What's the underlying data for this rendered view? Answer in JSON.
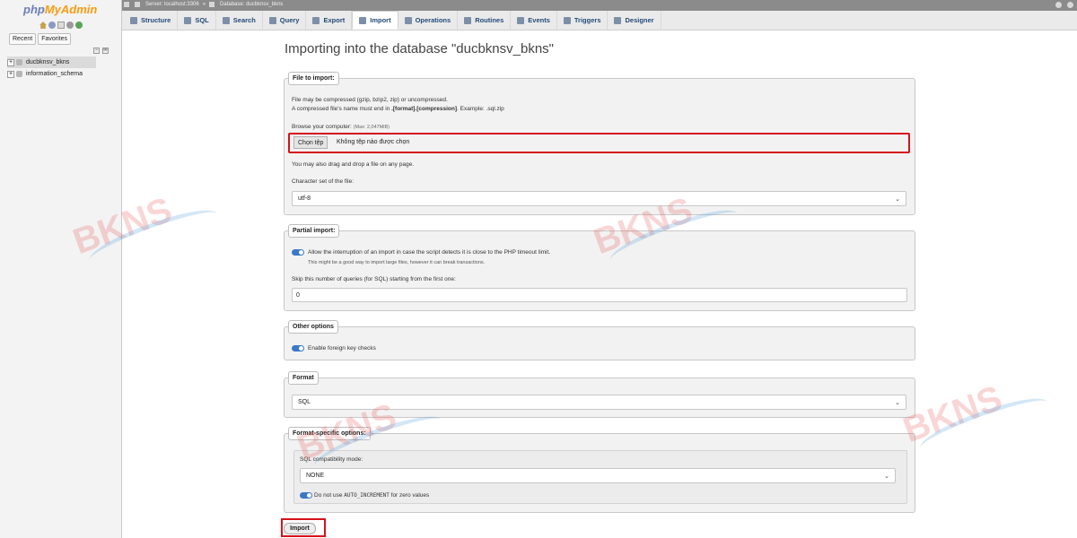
{
  "sidebar": {
    "logo_php": "php",
    "logo_myadmin": "MyAdmin",
    "recent": "Recent",
    "favorites": "Favorites",
    "databases": [
      "ducbknsv_bkns",
      "information_schema"
    ]
  },
  "breadcrumb": {
    "server": "Server: localhost:3306",
    "separator": "»",
    "database": "Database: ducbknsv_bkns"
  },
  "tabs": [
    {
      "label": "Structure"
    },
    {
      "label": "SQL"
    },
    {
      "label": "Search"
    },
    {
      "label": "Query"
    },
    {
      "label": "Export"
    },
    {
      "label": "Import"
    },
    {
      "label": "Operations"
    },
    {
      "label": "Routines"
    },
    {
      "label": "Events"
    },
    {
      "label": "Triggers"
    },
    {
      "label": "Designer"
    }
  ],
  "main": {
    "title": "Importing into the database \"ducbknsv_bkns\"",
    "file_section": {
      "legend": "File to import:",
      "note1": "File may be compressed (gzip, bzip2, zip) or uncompressed.",
      "note2_pre": "A compressed file's name must end in ",
      "note2_bold": ".[format].[compression]",
      "note2_post": ". Example: .sql.zip",
      "browse_label": "Browse your computer:",
      "max_size": "(Max: 2,047MiB)",
      "choose_file": "Chọn tệp",
      "no_file": "Không tệp nào được chọn",
      "drag_note": "You may also drag and drop a file on any page.",
      "charset_label": "Character set of the file:",
      "charset_value": "utf-8"
    },
    "partial_section": {
      "legend": "Partial import:",
      "allow_label": "Allow the interruption of an import in case the script detects it is close to the PHP timeout limit.",
      "allow_note": "This might be a good way to import large files, however it can break transactions.",
      "skip_label": "Skip this number of queries (for SQL) starting from the first one:",
      "skip_value": "0"
    },
    "other_section": {
      "legend": "Other options",
      "fk_label": "Enable foreign key checks"
    },
    "format_section": {
      "legend": "Format",
      "format_value": "SQL"
    },
    "format_specific": {
      "legend": "Format-specific options:",
      "compat_label": "SQL compatibility mode:",
      "compat_value": "NONE",
      "autoinc_pre": "Do not use ",
      "autoinc_code": "AUTO_INCREMENT",
      "autoinc_post": " for zero values"
    },
    "import_button": "Import"
  },
  "watermark": "BKNS"
}
